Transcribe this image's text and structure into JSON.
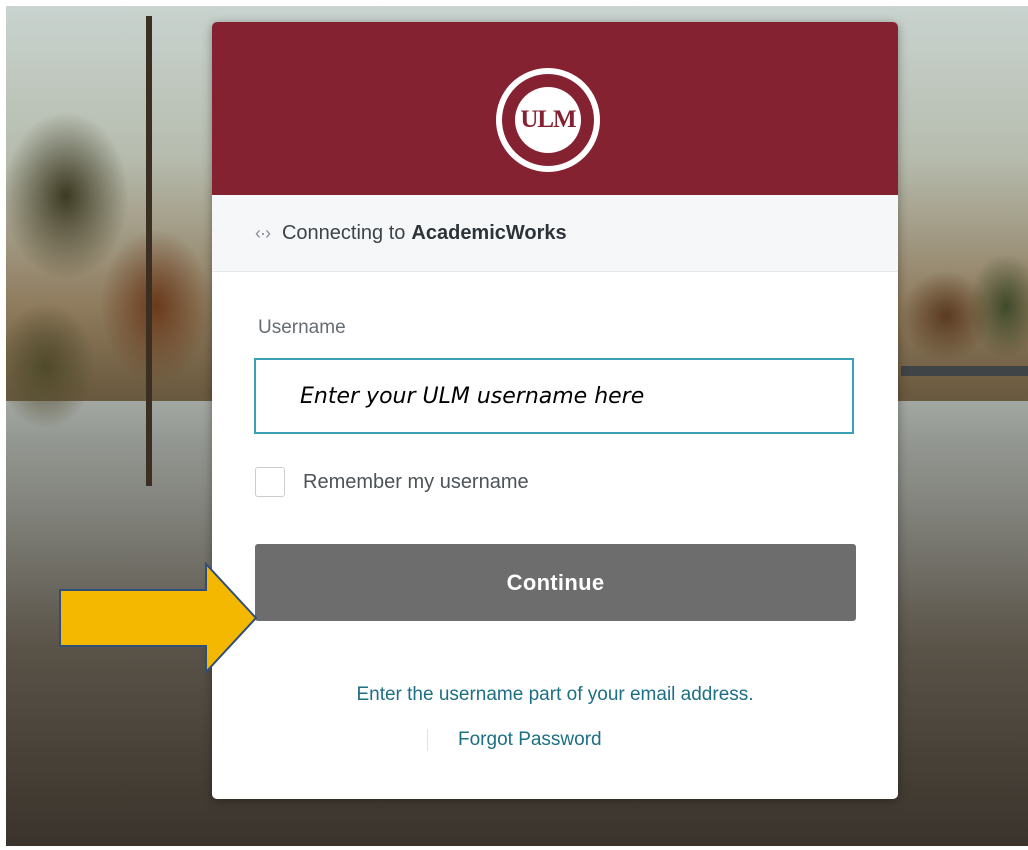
{
  "brand": {
    "header_color": "#852231",
    "logo_text": "ULM",
    "logo_icon": "university-seal-icon"
  },
  "connection": {
    "icon": "swap-arrows-icon",
    "icon_glyph": "‹·›",
    "prefix": "Connecting to",
    "app_name": "AcademicWorks"
  },
  "form": {
    "username_label": "Username",
    "username_placeholder": "Enter your ULM username here",
    "username_value": "",
    "remember_label": "Remember my username",
    "remember_checked": false,
    "continue_label": "Continue",
    "continue_color": "#6d6d6d"
  },
  "footer": {
    "hint": "Enter the username part of your email address.",
    "forgot_password": "Forgot Password",
    "link_color": "#1d6f84"
  },
  "annotation": {
    "icon": "pointer-arrow-icon",
    "color": "#f5b800"
  }
}
